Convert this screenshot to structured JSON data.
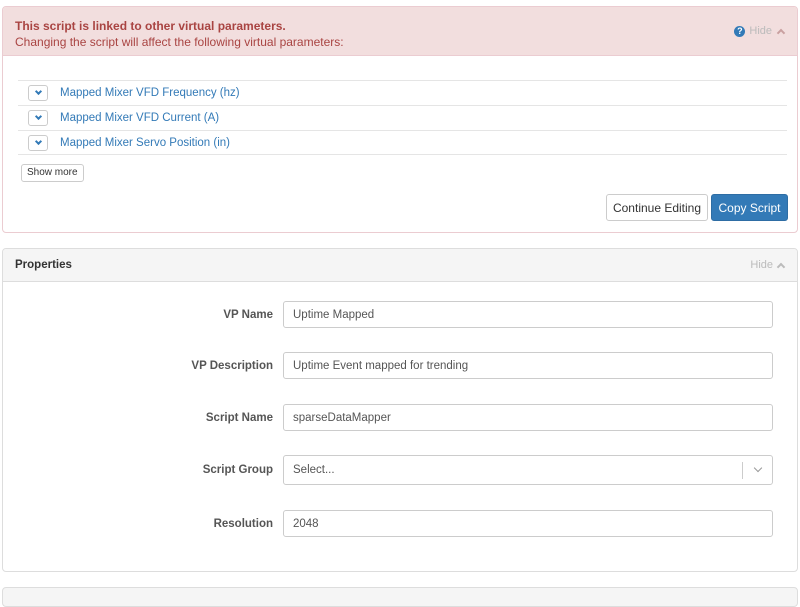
{
  "warning": {
    "title": "This script is linked to other virtual parameters.",
    "subtitle": "Changing the script will affect the following virtual parameters:",
    "hide_label": "Hide",
    "linked_vps": [
      {
        "label": "Mapped Mixer VFD Frequency (hz)"
      },
      {
        "label": "Mapped Mixer VFD Current (A)"
      },
      {
        "label": "Mapped Mixer Servo Position (in)"
      }
    ],
    "show_more_label": "Show more",
    "continue_label": "Continue Editing",
    "copy_label": "Copy Script"
  },
  "properties": {
    "title": "Properties",
    "hide_label": "Hide",
    "fields": {
      "vp_name": {
        "label": "VP Name",
        "value": "Uptime Mapped"
      },
      "vp_description": {
        "label": "VP Description",
        "value": "Uptime Event mapped for trending"
      },
      "script_name": {
        "label": "Script Name",
        "value": "sparseDataMapper"
      },
      "script_group": {
        "label": "Script Group",
        "value": "Select..."
      },
      "resolution": {
        "label": "Resolution",
        "value": "2048"
      }
    }
  },
  "colors": {
    "danger_bg": "#f2dede",
    "danger_text": "#a94442",
    "primary": "#337ab7"
  }
}
